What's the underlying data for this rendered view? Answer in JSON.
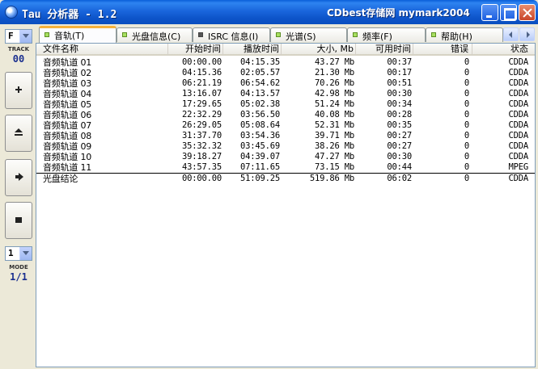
{
  "window": {
    "title": "Tau 分析器 - 1.2",
    "title_right": "CDbest存储网 mymark2004"
  },
  "left_panel": {
    "drive": "F",
    "track_label": "TRACK",
    "track_value": "00",
    "mode_select": "1",
    "mode_label": "MODE",
    "mode_value": "1/1"
  },
  "tabs": [
    {
      "label": "音轨(T)",
      "marker": "green"
    },
    {
      "label": "光盘信息(C)",
      "marker": "green"
    },
    {
      "label": "ISRC 信息(I)",
      "marker": "gray"
    },
    {
      "label": "光谱(S)",
      "marker": "green"
    },
    {
      "label": "频率(F)",
      "marker": "green"
    },
    {
      "label": "帮助(H)",
      "marker": "green"
    }
  ],
  "columns": [
    "文件名称",
    "开始时间",
    "播放时间",
    "大小, Mb",
    "可用时间",
    "错误",
    "状态"
  ],
  "rows": [
    {
      "name": "音频轨道 01",
      "start": "00:00.00",
      "play": "04:15.35",
      "size": "43.27 Mb",
      "avail": "00:37",
      "err": "0",
      "status": "CDDA"
    },
    {
      "name": "音频轨道 02",
      "start": "04:15.36",
      "play": "02:05.57",
      "size": "21.30 Mb",
      "avail": "00:17",
      "err": "0",
      "status": "CDDA"
    },
    {
      "name": "音频轨道 03",
      "start": "06:21.19",
      "play": "06:54.62",
      "size": "70.26 Mb",
      "avail": "00:51",
      "err": "0",
      "status": "CDDA"
    },
    {
      "name": "音频轨道 04",
      "start": "13:16.07",
      "play": "04:13.57",
      "size": "42.98 Mb",
      "avail": "00:30",
      "err": "0",
      "status": "CDDA"
    },
    {
      "name": "音频轨道 05",
      "start": "17:29.65",
      "play": "05:02.38",
      "size": "51.24 Mb",
      "avail": "00:34",
      "err": "0",
      "status": "CDDA"
    },
    {
      "name": "音频轨道 06",
      "start": "22:32.29",
      "play": "03:56.50",
      "size": "40.08 Mb",
      "avail": "00:28",
      "err": "0",
      "status": "CDDA"
    },
    {
      "name": "音频轨道 07",
      "start": "26:29.05",
      "play": "05:08.64",
      "size": "52.31 Mb",
      "avail": "00:35",
      "err": "0",
      "status": "CDDA"
    },
    {
      "name": "音频轨道 08",
      "start": "31:37.70",
      "play": "03:54.36",
      "size": "39.71 Mb",
      "avail": "00:27",
      "err": "0",
      "status": "CDDA"
    },
    {
      "name": "音频轨道 09",
      "start": "35:32.32",
      "play": "03:45.69",
      "size": "38.26 Mb",
      "avail": "00:27",
      "err": "0",
      "status": "CDDA"
    },
    {
      "name": "音频轨道 10",
      "start": "39:18.27",
      "play": "04:39.07",
      "size": "47.27 Mb",
      "avail": "00:30",
      "err": "0",
      "status": "CDDA"
    },
    {
      "name": "音频轨道 11",
      "start": "43:57.35",
      "play": "07:11.65",
      "size": "73.15 Mb",
      "avail": "00:44",
      "err": "0",
      "status": "MPEG"
    }
  ],
  "summary": {
    "name": "光盘结论",
    "start": "00:00.00",
    "play": "51:09.25",
    "size": "519.86 Mb",
    "avail": "06:02",
    "err": "0",
    "status": "CDDA"
  }
}
